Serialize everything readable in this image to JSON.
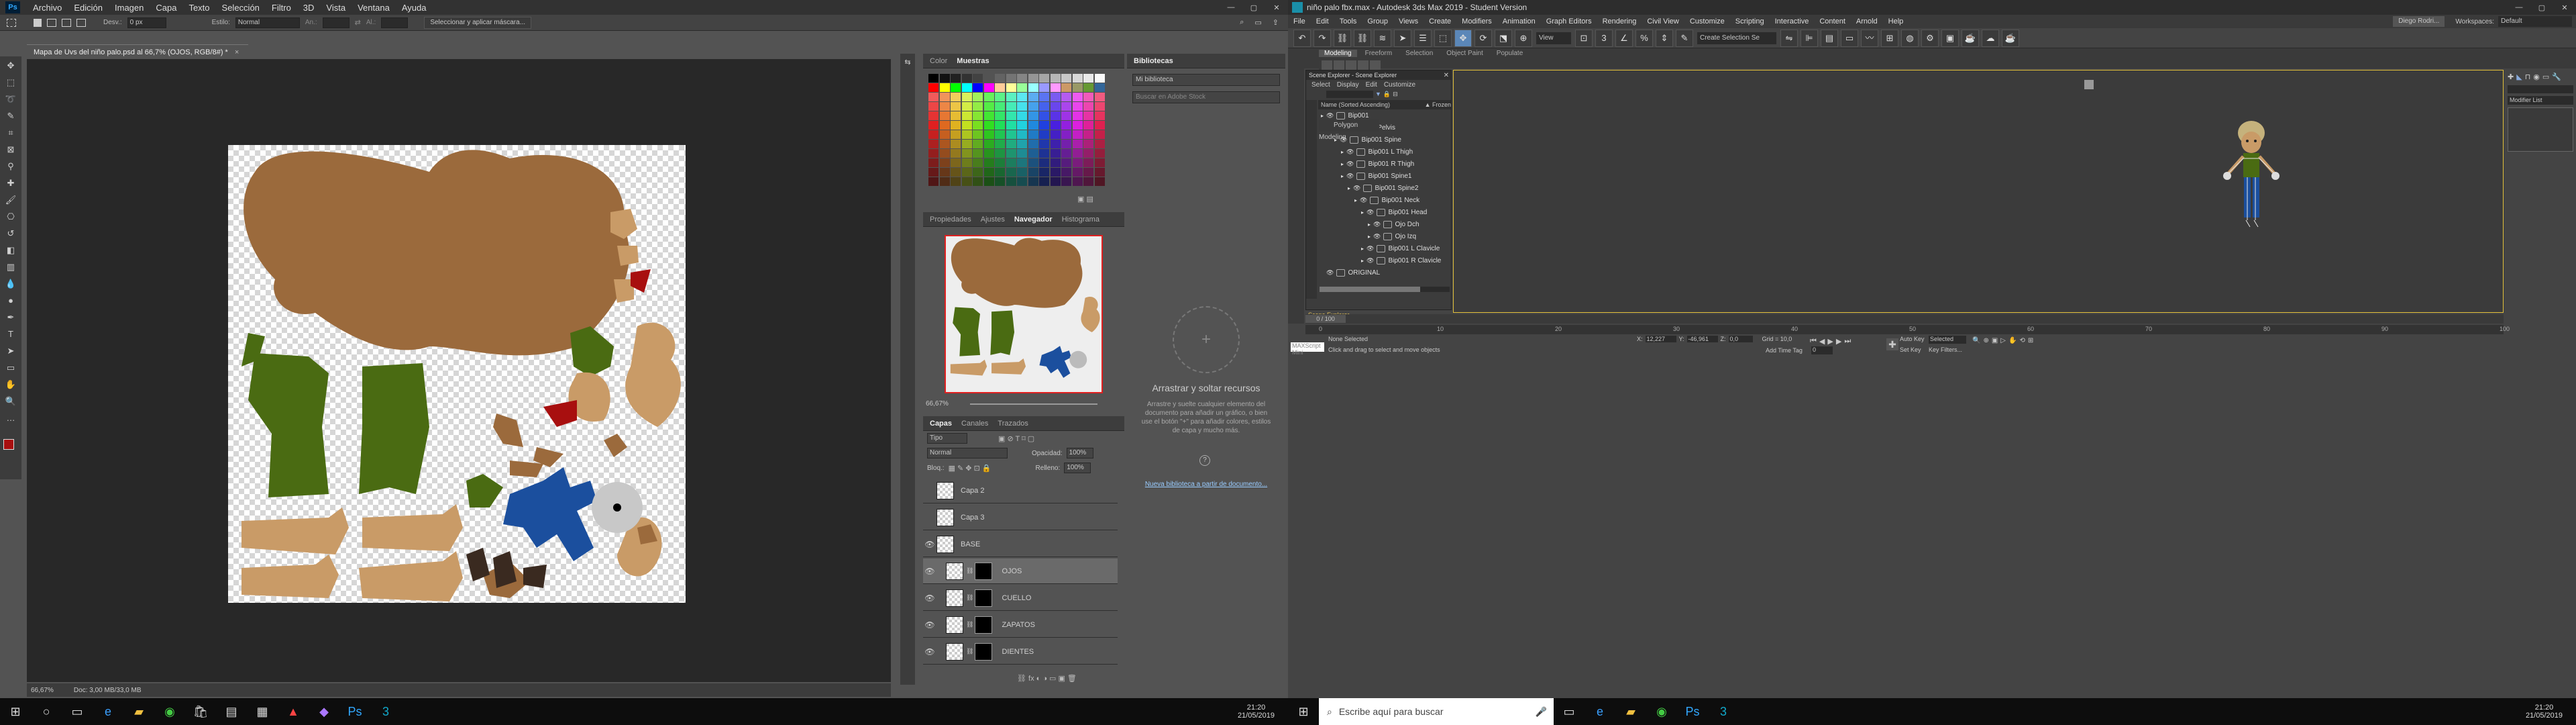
{
  "ps": {
    "menu": [
      "Archivo",
      "Edición",
      "Imagen",
      "Capa",
      "Texto",
      "Selección",
      "Filtro",
      "3D",
      "Vista",
      "Ventana",
      "Ayuda"
    ],
    "options": {
      "desv_label": "Desv.:",
      "desv_value": "0 px",
      "estilo_label": "Estilo:",
      "estilo_value": "Normal",
      "an_label": "An.:",
      "al_label": "Al.:",
      "select_mask": "Seleccionar y aplicar máscara..."
    },
    "doc_tab": "Mapa de Uvs del niño palo.psd al 66,7% (OJOS, RGB/8#) *",
    "status_zoom": "66,67%",
    "status_doc": "Doc: 3,00 MB/33,0 MB",
    "color_tabs": [
      "Color",
      "Muestras"
    ],
    "lib_tab": "Bibliotecas",
    "lib_select": "Mi biblioteca",
    "lib_search": "Buscar en Adobe Stock",
    "lib_drop_title": "Arrastrar y soltar recursos",
    "lib_drop_text": "Arrastre y suelte cualquier elemento del documento para añadir un gráfico, o bien use el botón \"+\" para añadir colores, estilos de capa y mucho más.",
    "lib_link": "Nueva biblioteca a partir de documento...",
    "nav_tabs": [
      "Propiedades",
      "Ajustes",
      "Navegador",
      "Histograma"
    ],
    "nav_zoom": "66,67%",
    "layer_tabs": [
      "Capas",
      "Canales",
      "Trazados"
    ],
    "layer_filter": "Tipo",
    "blend": "Normal",
    "opacity_label": "Opacidad:",
    "opacity_value": "100%",
    "lock_label": "Bloq.:",
    "fill_label": "Relleno:",
    "fill_value": "100%",
    "layers": [
      {
        "name": "Capa 2"
      },
      {
        "name": "Capa 3"
      },
      {
        "name": "BASE"
      },
      {
        "name": "OJOS"
      },
      {
        "name": "CUELLO"
      },
      {
        "name": "ZAPATOS"
      },
      {
        "name": "DIENTES"
      }
    ]
  },
  "max": {
    "title": "niño palo fbx.max - Autodesk 3ds Max 2019 - Student Version",
    "menu": [
      "File",
      "Edit",
      "Tools",
      "Group",
      "Views",
      "Create",
      "Modifiers",
      "Animation",
      "Graph Editors",
      "Rendering",
      "Civil View",
      "Customize",
      "Scripting",
      "Interactive",
      "Content",
      "Arnold",
      "Help"
    ],
    "user": "Diego Rodri...",
    "workspaces_label": "Workspaces:",
    "workspaces_value": "Default",
    "view_dropdown": "View",
    "selset": "Create Selection Se",
    "ribbon_tabs": [
      "Modeling",
      "Freeform",
      "Selection",
      "Object Paint",
      "Populate"
    ],
    "ribbon_label": "Polygon Modeling",
    "scene_explorer_title": "Scene Explorer - Scene Explorer",
    "se_menu": [
      "Select",
      "Display",
      "Edit",
      "Customize"
    ],
    "se_col": "Name (Sorted Ascending)",
    "se_col2": "▲ Frozen",
    "tree": [
      {
        "name": "Bip001",
        "lvl": 0
      },
      {
        "name": "Bip001 Pelvis",
        "lvl": 1
      },
      {
        "name": "Bip001 Spine",
        "lvl": 2
      },
      {
        "name": "Bip001 L Thigh",
        "lvl": 3
      },
      {
        "name": "Bip001 R Thigh",
        "lvl": 3
      },
      {
        "name": "Bip001 Spine1",
        "lvl": 3
      },
      {
        "name": "Bip001 Spine2",
        "lvl": 4
      },
      {
        "name": "Bip001 Neck",
        "lvl": 5
      },
      {
        "name": "Bip001 Head",
        "lvl": 6
      },
      {
        "name": "Ojo Dch",
        "lvl": 7
      },
      {
        "name": "Ojo Izq",
        "lvl": 7
      },
      {
        "name": "Bip001 L Clavicle",
        "lvl": 6
      },
      {
        "name": "Bip001 R Clavicle",
        "lvl": 6
      },
      {
        "name": "ORIGINAL",
        "lvl": -1
      }
    ],
    "se_footer": "Scene Explorer",
    "modifier_list": "Modifier List",
    "timeline": "0 / 100",
    "status1": "None Selected",
    "status2": "Click and drag to select and move objects",
    "script": "MAXScript Mini",
    "x_label": "X:",
    "x_val": "12,227",
    "y_label": "Y:",
    "y_val": "-46,961",
    "z_label": "Z:",
    "z_val": "0,0",
    "grid": "Grid = 10,0",
    "autokey": "Auto Key",
    "autokey_val": "Selected",
    "setkey": "Set Key",
    "keyfilters": "Key Filters...",
    "addtimetag": "Add Time Tag",
    "frame": "0",
    "ticks": [
      "0",
      "10",
      "20",
      "30",
      "40",
      "50",
      "60",
      "70",
      "80",
      "90",
      "100"
    ]
  },
  "taskbar_left": {
    "time": "21:20",
    "date": "21/05/2019"
  },
  "taskbar_right": {
    "search": "Escribe aquí para buscar",
    "time": "21:20",
    "date": "21/05/2019"
  },
  "colors": {
    "brown": "#9b6a3c",
    "green": "#4a6b12",
    "skin": "#c99b67",
    "blue": "#1b4f9e",
    "red": "#a80f0f"
  }
}
